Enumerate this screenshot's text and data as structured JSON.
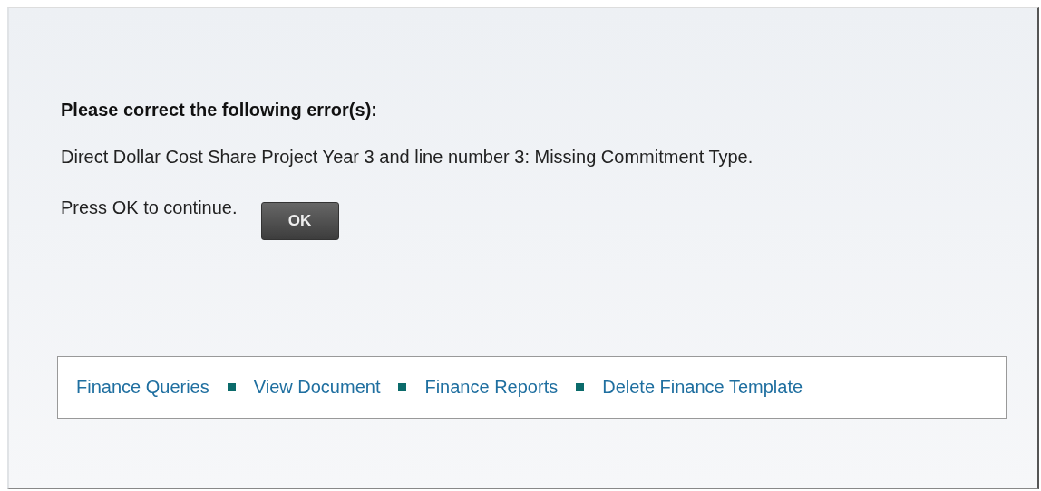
{
  "heading": "Please correct the following error(s):",
  "message": "Direct Dollar Cost Share Project Year 3 and line number 3: Missing Commitment Type.",
  "prompt": "Press OK to continue.",
  "ok_button": "OK",
  "links": [
    "Finance Queries",
    "View Document",
    "Finance Reports",
    "Delete Finance Template"
  ]
}
